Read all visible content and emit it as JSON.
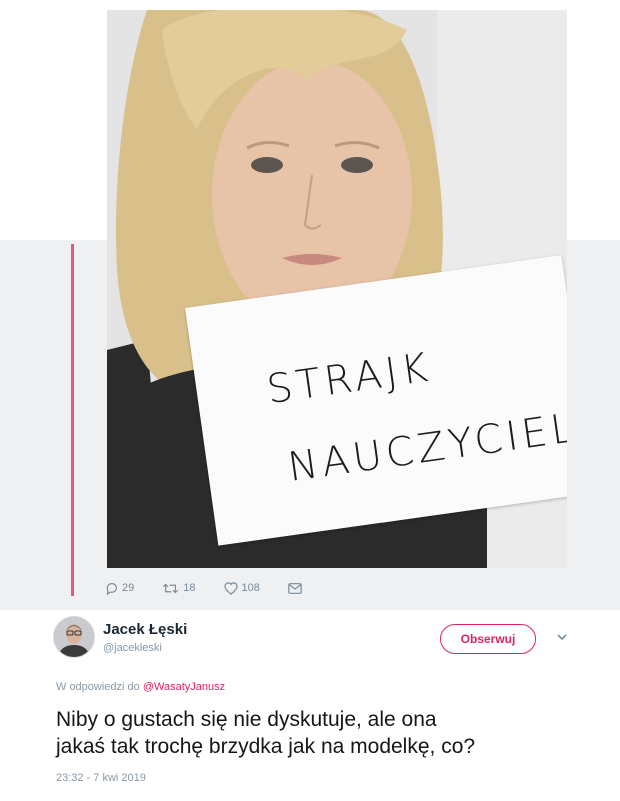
{
  "photo": {
    "sign_line1": "STRAJK",
    "sign_line2": "NAUCZYCIELI"
  },
  "actions": {
    "replies": "29",
    "retweets": "18",
    "likes": "108"
  },
  "author": {
    "name": "Jacek Łęski",
    "handle": "@jacekleski"
  },
  "follow_button": "Obserwuj",
  "reply": {
    "prefix": "W odpowiedzi do",
    "mention": "@WasatyJanusz"
  },
  "tweet": {
    "line1": "Niby o gustach się nie dyskutuje, ale ona",
    "line2": "jakaś tak trochę brzydka jak na modelkę, co?"
  },
  "timestamp": "23:32 - 7 kwi 2019",
  "colors": {
    "accent": "#e0245e",
    "muted": "#8899a6",
    "text": "#14171a"
  },
  "icons": [
    "reply-icon",
    "retweet-icon",
    "like-icon",
    "dm-icon",
    "chevron-down-icon"
  ]
}
